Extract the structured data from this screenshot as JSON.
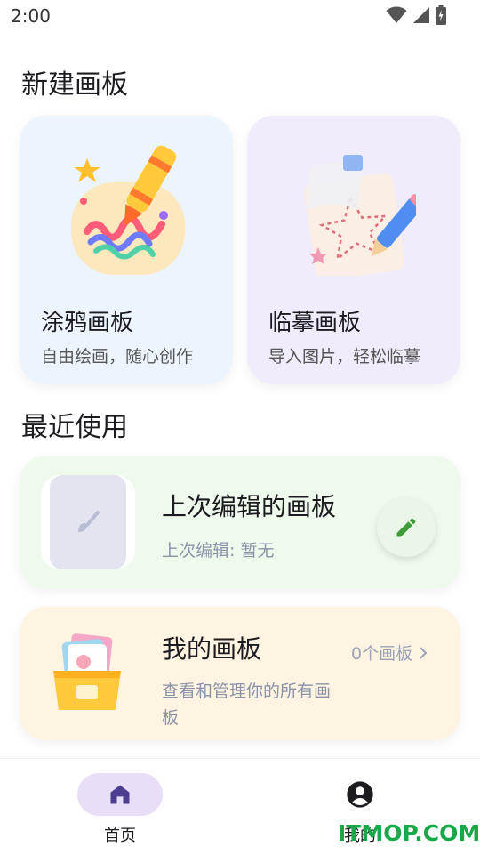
{
  "status": {
    "time": "2:00"
  },
  "new_board": {
    "title": "新建画板",
    "cards": [
      {
        "title": "涂鸦画板",
        "subtitle": "自由绘画，随心创作",
        "bg": "#ecf4fe"
      },
      {
        "title": "临摹画板",
        "subtitle": "导入图片，轻松临摹",
        "bg": "#f0ecfc"
      }
    ]
  },
  "recent": {
    "title": "最近使用",
    "last_edited": {
      "title": "上次编辑的画板",
      "subtitle": "上次编辑: 暂无"
    },
    "my_boards": {
      "title": "我的画板",
      "subtitle": "查看和管理你的所有画板",
      "count": "0个画板"
    }
  },
  "nav": {
    "items": [
      {
        "label": "首页",
        "icon": "home-icon",
        "active": true
      },
      {
        "label": "我的",
        "icon": "account-circle-icon",
        "active": false
      }
    ]
  },
  "watermark": "ITMOP.COM",
  "colors": {
    "accent": "#4f3e8f",
    "active_pill": "#e8def8",
    "fab_icon": "#3f9a3a"
  }
}
